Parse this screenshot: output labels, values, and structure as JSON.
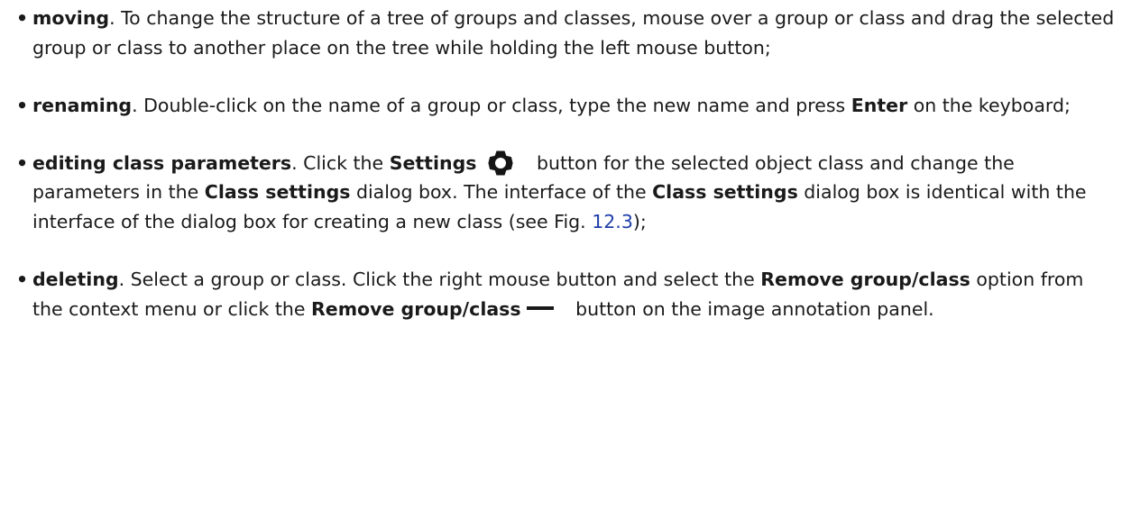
{
  "bullet_glyph": "•",
  "items": [
    {
      "term": "moving",
      "text": ". To change the structure of a tree of groups and classes, mouse over a group or class and drag the selected group or class to another place on the tree while holding the left mouse button;"
    },
    {
      "term": "renaming",
      "text1": ". Double-click on the name of a group or class, type the new name and press ",
      "key": "Enter",
      "text2": " on the keyboard;"
    },
    {
      "term": "editing class parameters",
      "text1": ". Click the ",
      "settings_label": "Settings",
      "text2": " button for the selected object class and change the parameters in the ",
      "dialog_name_1": "Class settings",
      "text3": " dialog box. The interface of the ",
      "dialog_name_2": "Class settings",
      "text4": " dialog box is identical with the interface of the dialog box for creating a new class (see Fig. ",
      "fig_ref": "12.3",
      "text5": ");",
      "icon": "gear-icon"
    },
    {
      "term": "deleting",
      "text1": ". Select a group or class. Click the right mouse button and select the ",
      "option_1": "Remove group/class",
      "text2": " option from the context menu or click the ",
      "option_2": "Remove group/class",
      "text3": " button on the image annotation panel.",
      "icon": "minus-icon"
    }
  ]
}
